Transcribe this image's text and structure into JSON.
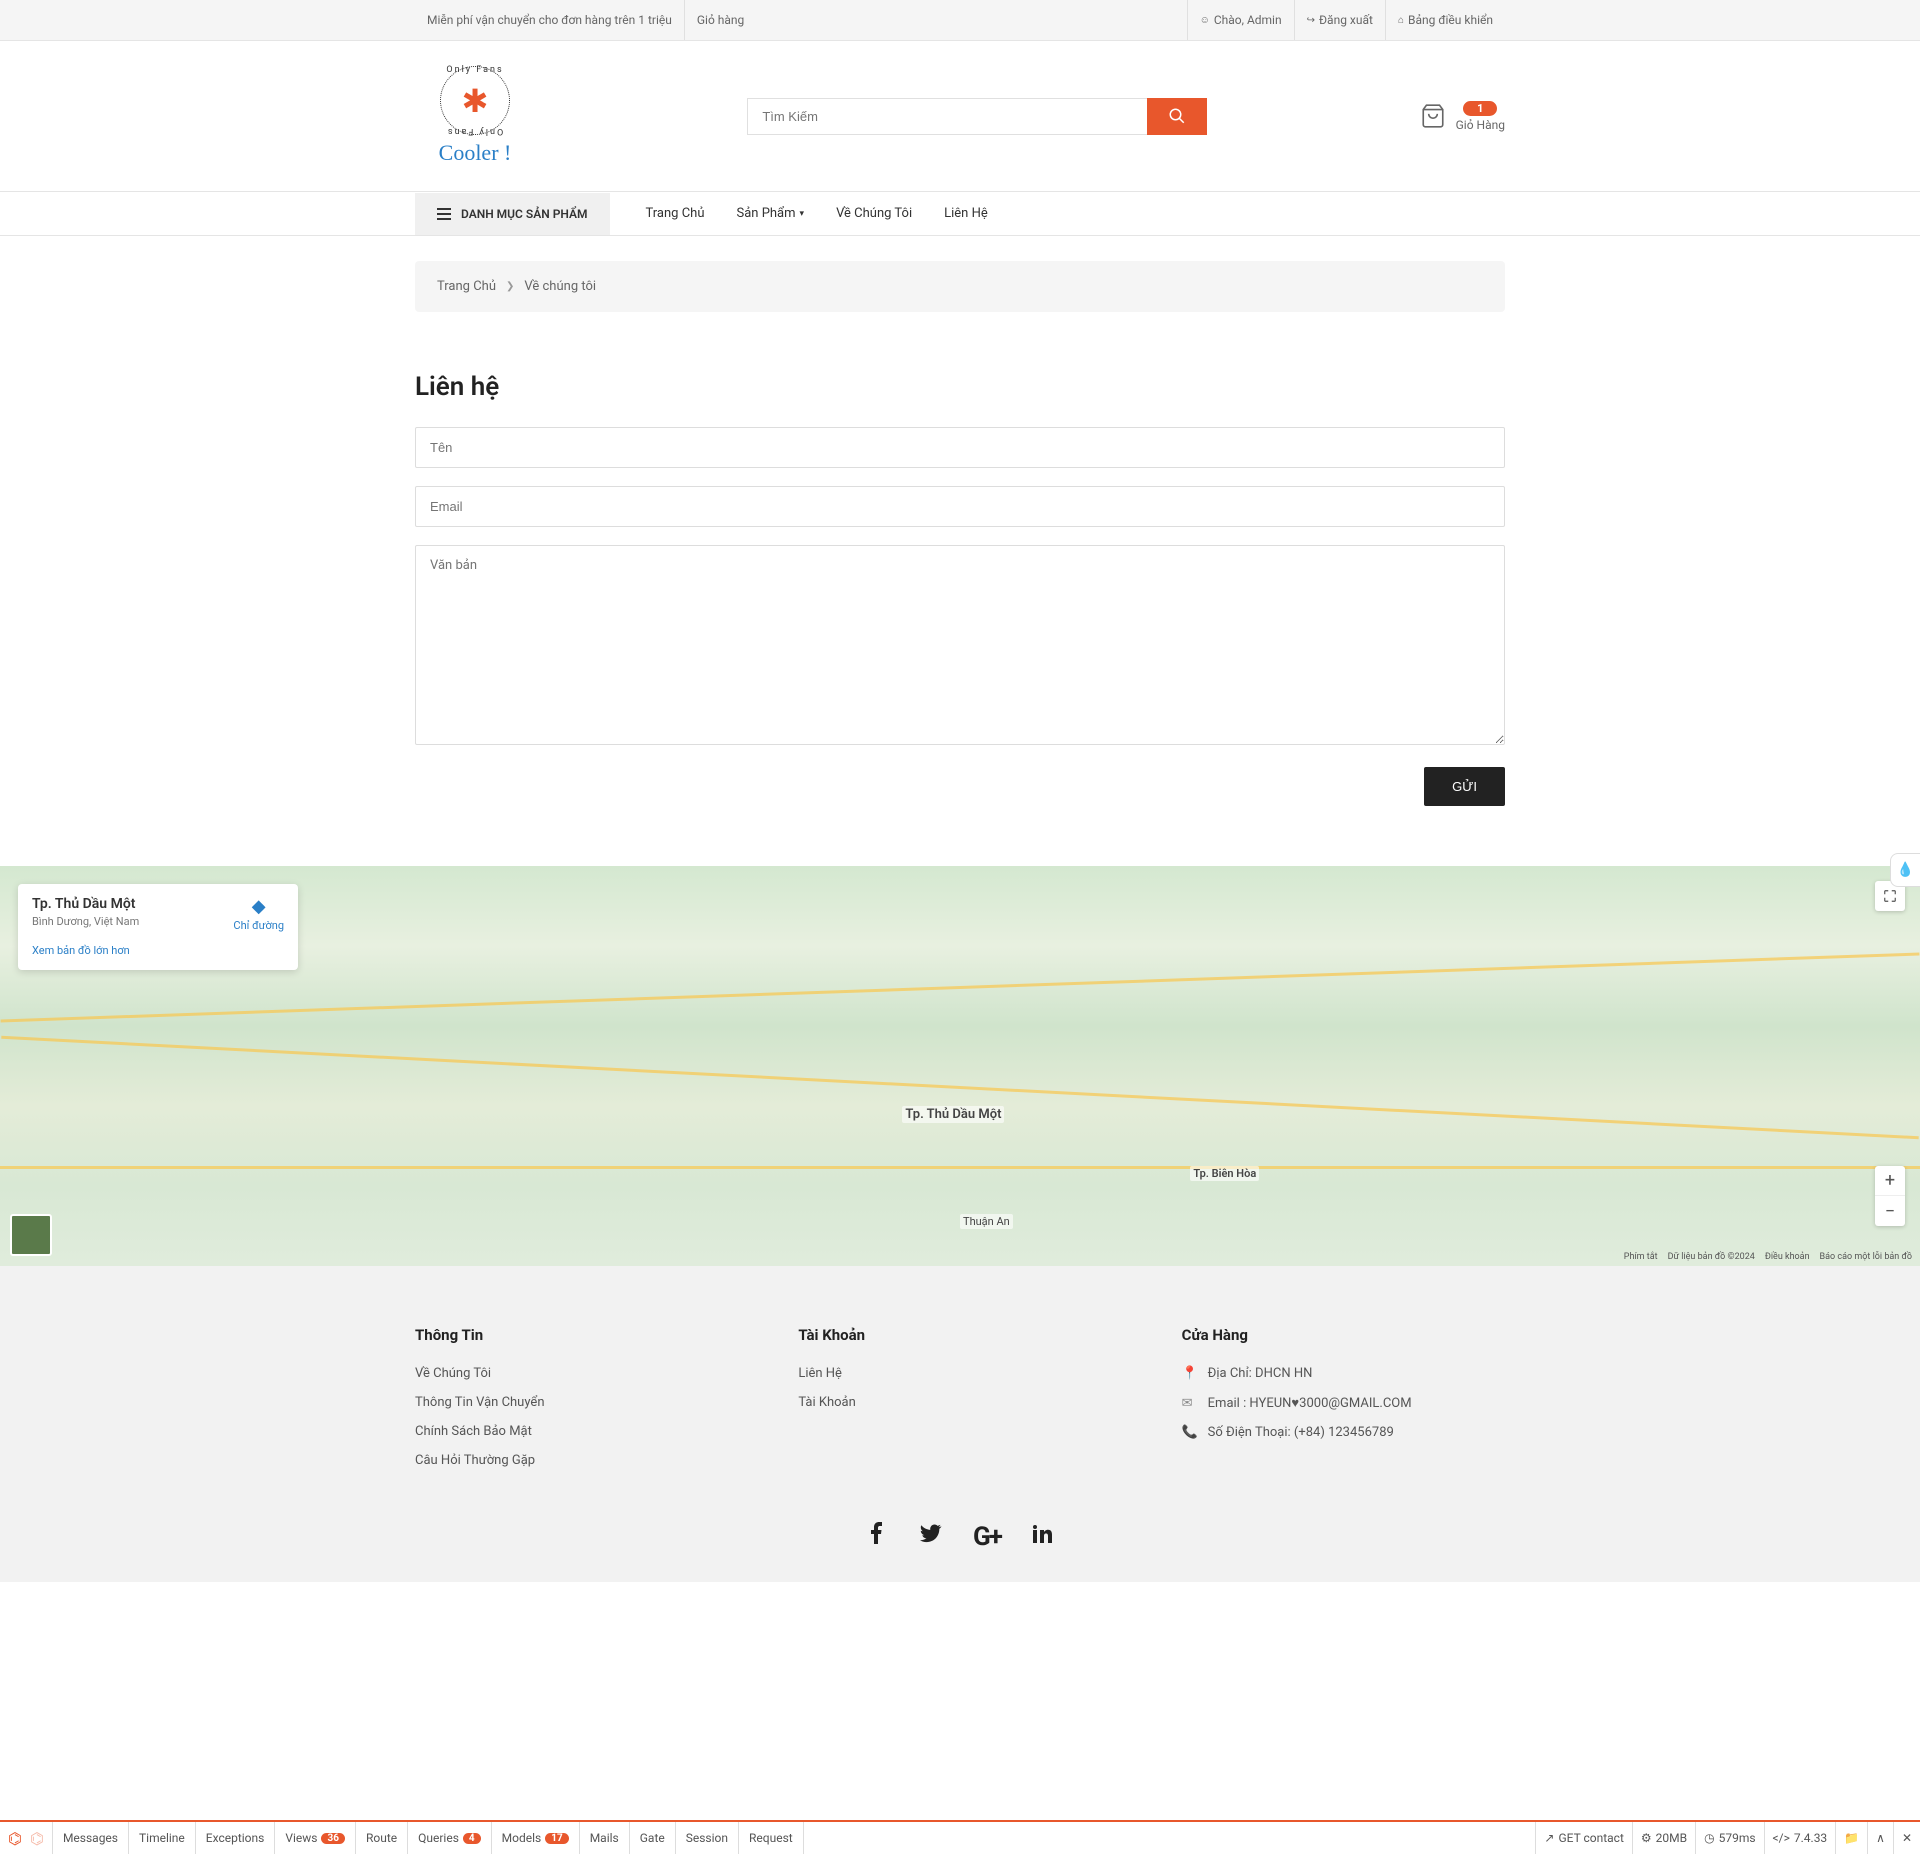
{
  "topbar": {
    "shipping": "Miễn phí vận chuyển cho đơn hàng trên 1 triệu",
    "cart": "Giỏ hàng",
    "greeting": "Chào, Admin",
    "logout": "Đăng xuất",
    "dashboard": "Bảng điều khiển"
  },
  "logo": {
    "text_curve": "Only Fans",
    "text": "Cooler !"
  },
  "search": {
    "placeholder": "Tìm Kiếm"
  },
  "cart": {
    "count": "1",
    "label": "Giỏ Hàng"
  },
  "nav": {
    "categories": "DANH MỤC SẢN PHẨM",
    "links": [
      "Trang Chủ",
      "Sản Phẩm",
      "Về Chúng Tôi",
      "Liên Hệ"
    ]
  },
  "breadcrumb": {
    "home": "Trang Chủ",
    "current": "Về chúng tôi"
  },
  "contact": {
    "title": "Liên hệ",
    "name_placeholder": "Tên",
    "email_placeholder": "Email",
    "message_placeholder": "Văn bản",
    "submit": "GỬI"
  },
  "map": {
    "card_title": "Tp. Thủ Dầu Một",
    "card_sub": "Bình Dương, Việt Nam",
    "directions": "Chỉ đường",
    "view_larger": "Xem bản đồ lớn hơn",
    "footer": {
      "shortcuts": "Phím tắt",
      "data": "Dữ liệu bản đồ ©2024",
      "terms": "Điều khoản",
      "report": "Báo cáo một lỗi bản đồ"
    },
    "labels": {
      "city1": "Tp. Thủ Dầu Một",
      "city2": "Tp. Biên Hòa",
      "city3": "Thuận An"
    }
  },
  "footer": {
    "col1": {
      "heading": "Thông Tin",
      "links": [
        "Về Chúng Tôi",
        "Thông Tin Vận Chuyển",
        "Chính Sách Bảo Mật",
        "Câu Hỏi Thường Gặp"
      ]
    },
    "col2": {
      "heading": "Tài Khoản",
      "links": [
        "Liên Hệ",
        "Tài Khoản"
      ]
    },
    "col3": {
      "heading": "Cửa Hàng",
      "address": "Địa Chỉ: DHCN HN",
      "email": "Email : HYEUN♥3000@GMAIL.COM",
      "phone": "Số Điện Thoại: (+84) 123456789"
    }
  },
  "debugbar": {
    "left": [
      {
        "label": "Messages"
      },
      {
        "label": "Timeline"
      },
      {
        "label": "Exceptions"
      },
      {
        "label": "Views",
        "badge": "36"
      },
      {
        "label": "Route"
      },
      {
        "label": "Queries",
        "badge": "4"
      },
      {
        "label": "Models",
        "badge": "17"
      },
      {
        "label": "Mails"
      },
      {
        "label": "Gate"
      },
      {
        "label": "Session"
      },
      {
        "label": "Request"
      }
    ],
    "right": {
      "route": "GET contact",
      "memory": "20MB",
      "time": "579ms",
      "version": "7.4.33"
    }
  }
}
